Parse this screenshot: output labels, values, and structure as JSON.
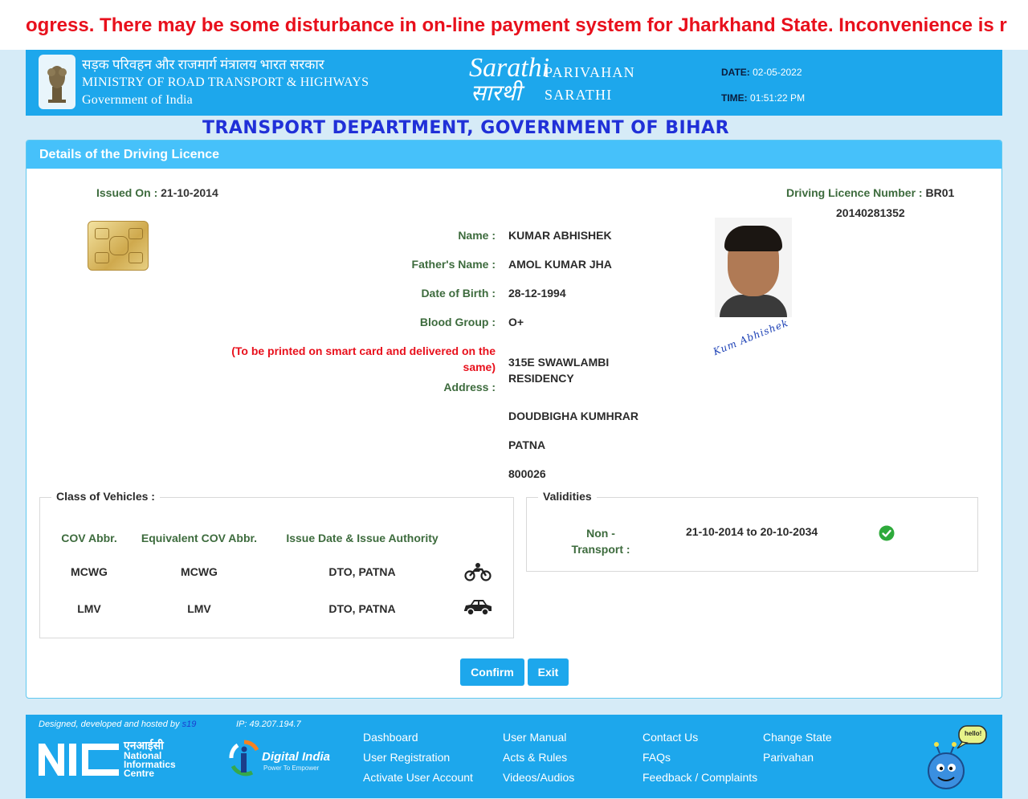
{
  "marquee": {
    "text": "ogress. There may be some disturbance in on-line payment system for Jharkhand State. Inconvenience is r"
  },
  "header": {
    "ministry_hindi": "सड़क परिवहन और राजमार्ग मंत्रालय भारत सरकार",
    "ministry_line1": "MINISTRY OF ROAD TRANSPORT & HIGHWAYS",
    "ministry_line2": "Government of India",
    "logo_script_en": "Sarathi",
    "logo_script_hi": "सारथी",
    "logo_word1": "PARIVAHAN",
    "logo_word2": "SARATHI",
    "date_label": "DATE:",
    "date_value": "02-05-2022",
    "time_label": "TIME:",
    "time_value": "01:51:22 PM"
  },
  "dept_title": "TRANSPORT DEPARTMENT, GOVERNMENT OF BIHAR",
  "panel": {
    "title": "Details of the Driving Licence",
    "issued_on_label": "Issued On :",
    "issued_on_value": "21-10-2014",
    "dl_number_label": "Driving Licence Number :",
    "dl_number_part1": "BR01",
    "dl_number_part2": "20140281352",
    "fields": {
      "name_label": "Name :",
      "name_value": "KUMAR ABHISHEK",
      "father_label": "Father's Name :",
      "father_value": "AMOL KUMAR JHA",
      "dob_label": "Date of Birth :",
      "dob_value": "28-12-1994",
      "blood_label": "Blood Group :",
      "blood_value": "O+",
      "address_note": "(To be printed on smart card and delivered on the same)",
      "address_label": "Address :",
      "address_lines": [
        "315E SWAWLAMBI RESIDENCY",
        "DOUDBIGHA KUMHRAR",
        "PATNA",
        "800026"
      ]
    },
    "signature_text": "Kum Abhishek"
  },
  "class_of_vehicles": {
    "legend": "Class of Vehicles :",
    "headers": [
      "COV Abbr.",
      "Equivalent COV Abbr.",
      "Issue Date & Issue Authority"
    ],
    "rows": [
      {
        "cov": "MCWG",
        "equiv": "MCWG",
        "authority": "DTO, PATNA",
        "icon": "motorcycle-icon"
      },
      {
        "cov": "LMV",
        "equiv": "LMV",
        "authority": "DTO, PATNA",
        "icon": "car-icon"
      }
    ]
  },
  "validities": {
    "legend": "Validities",
    "type_label": "Non - Transport :",
    "range": "21-10-2014 to 20-10-2034",
    "status_icon": "check-circle-icon",
    "status_color": "#2eaa3b"
  },
  "buttons": {
    "confirm": "Confirm",
    "exit": "Exit"
  },
  "footer": {
    "credit_text": "Designed, developed and hosted by",
    "credit_link": "s19",
    "ip": "IP: 49.207.194.7",
    "nic_hindi": "एनआईसी",
    "nic_name": [
      "National",
      "Informatics",
      "Centre"
    ],
    "digital_india": "Digital India",
    "digital_india_tag": "Power To Empower",
    "links": {
      "dashboard": "Dashboard",
      "user_registration": "User Registration",
      "activate_user_account": "Activate User Account",
      "user_manual": "User Manual",
      "acts_rules": "Acts & Rules",
      "videos_audios": "Videos/Audios",
      "contact_us": "Contact Us",
      "faqs": "FAQs",
      "feedback": "Feedback / Complaints",
      "change_state": "Change State",
      "parivahan": "Parivahan"
    },
    "mascot_bubble": "hello!"
  },
  "colors": {
    "brand_blue": "#1da7ec",
    "panel_head": "#46c1fa",
    "label_green": "#3d6b3d",
    "alert_red": "#e8101c",
    "title_blue": "#2030d8"
  }
}
